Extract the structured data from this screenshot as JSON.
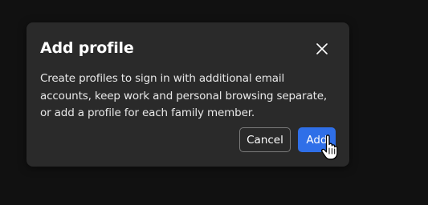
{
  "dialog": {
    "title": "Add profile",
    "description": "Create profiles to sign in with additional email accounts, keep work and personal browsing separate, or add a profile for each family member.",
    "cancel_label": "Cancel",
    "add_label": "Add",
    "close_icon": "close-icon"
  },
  "cursor": {
    "icon": "hand-pointer-icon"
  },
  "colors": {
    "background": "#111111",
    "dialog_bg": "#2a2a2a",
    "primary": "#2f6fe8",
    "text": "#ffffff"
  }
}
